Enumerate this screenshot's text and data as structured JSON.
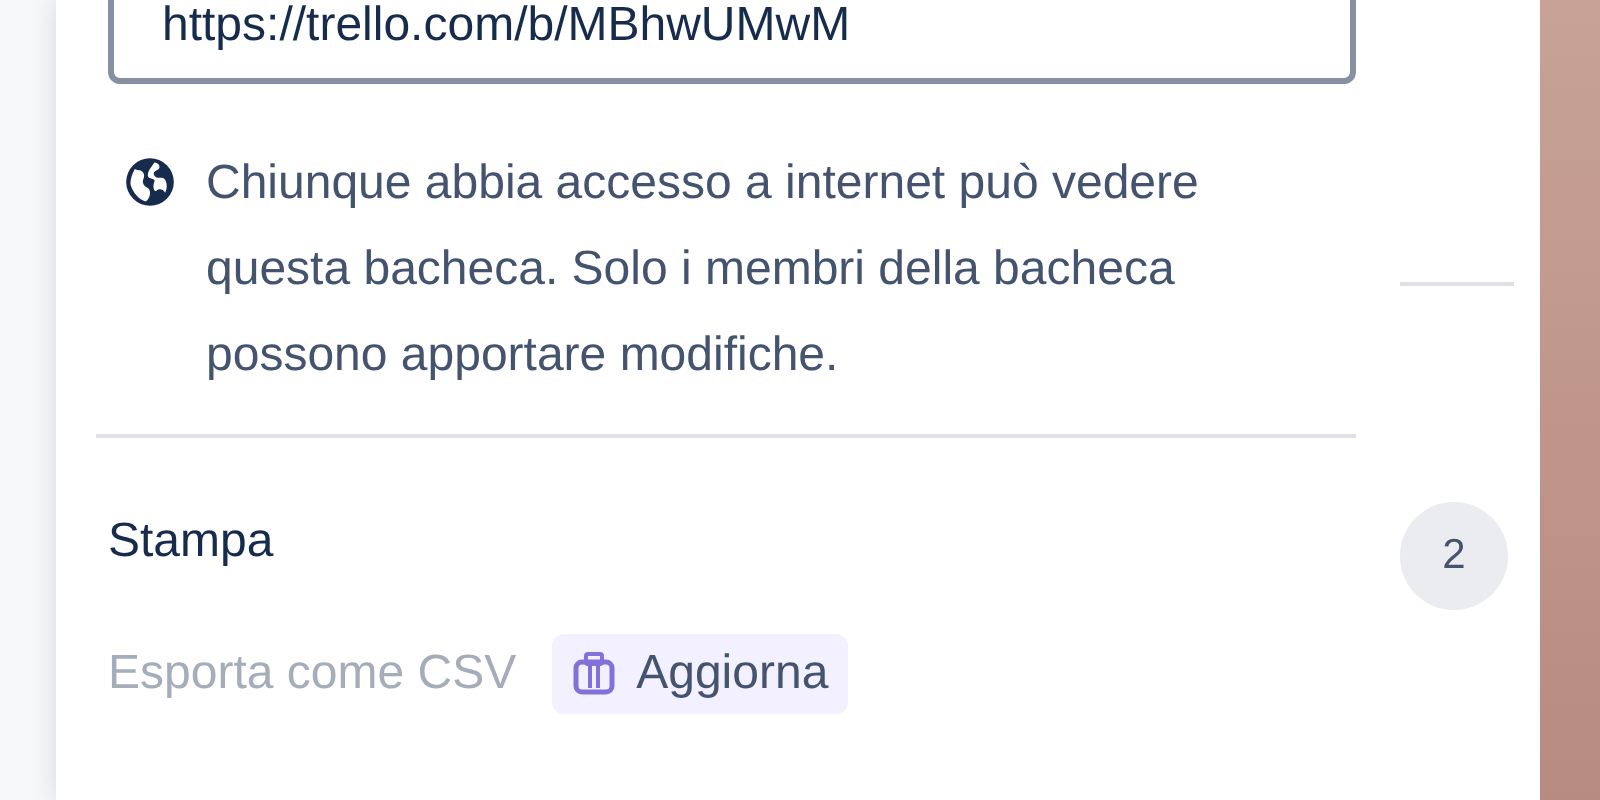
{
  "share_link": {
    "value": "https://trello.com/b/MBhwUMwM"
  },
  "visibility_note": "Chiunque abbia accesso a internet può vedere questa bacheca. Solo i membri della bacheca possono apportare modifiche.",
  "menu_items": [
    {
      "label": "Stampa",
      "disabled": false
    },
    {
      "label": "Esporta come CSV",
      "disabled": true,
      "badge": "Aggiorna"
    }
  ],
  "side_count": "2"
}
